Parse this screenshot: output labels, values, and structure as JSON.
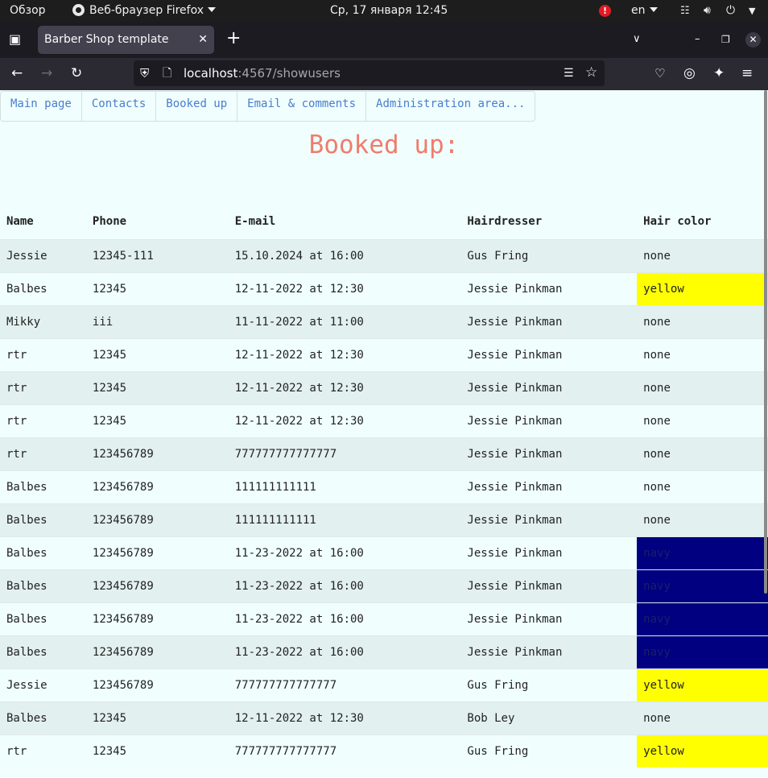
{
  "system_bar": {
    "activities": "Обзор",
    "app_name": "Веб-браузер Firefox",
    "clock": "Ср, 17 января  12:45",
    "notification_count": "!",
    "keyboard_layout": "en"
  },
  "browser": {
    "tab_title": "Barber Shop template",
    "url_host": "localhost",
    "url_rest": ":4567/showusers"
  },
  "menu": [
    "Main page",
    "Contacts",
    "Booked up",
    "Email & comments",
    "Administration area..."
  ],
  "page_title": "Booked up:",
  "table": {
    "headers": [
      "Name",
      "Phone",
      "E-mail",
      "Hairdresser",
      "Hair color"
    ],
    "rows": [
      [
        "Jessie",
        "12345-111",
        "15.10.2024 at 16:00",
        "Gus Fring",
        "none"
      ],
      [
        "Balbes",
        "12345",
        "12-11-2022 at 12:30",
        "Jessie Pinkman",
        "yellow"
      ],
      [
        "Mikky",
        "iii",
        "11-11-2022 at 11:00",
        "Jessie Pinkman",
        "none"
      ],
      [
        "rtr",
        "12345",
        "12-11-2022 at 12:30",
        "Jessie Pinkman",
        "none"
      ],
      [
        "rtr",
        "12345",
        "12-11-2022 at 12:30",
        "Jessie Pinkman",
        "none"
      ],
      [
        "rtr",
        "12345",
        "12-11-2022 at 12:30",
        "Jessie Pinkman",
        "none"
      ],
      [
        "rtr",
        "123456789",
        "777777777777777",
        "Jessie Pinkman",
        "none"
      ],
      [
        "Balbes",
        "123456789",
        "111111111111",
        "Jessie Pinkman",
        "none"
      ],
      [
        "Balbes",
        "123456789",
        "111111111111",
        "Jessie Pinkman",
        "none"
      ],
      [
        "Balbes",
        "123456789",
        "11-23-2022 at 16:00",
        "Jessie Pinkman",
        "navy"
      ],
      [
        "Balbes",
        "123456789",
        "11-23-2022 at 16:00",
        "Jessie Pinkman",
        "navy"
      ],
      [
        "Balbes",
        "123456789",
        "11-23-2022 at 16:00",
        "Jessie Pinkman",
        "navy"
      ],
      [
        "Balbes",
        "123456789",
        "11-23-2022 at 16:00",
        "Jessie Pinkman",
        "navy"
      ],
      [
        "Jessie",
        "123456789",
        "777777777777777",
        "Gus Fring",
        "yellow"
      ],
      [
        "Balbes",
        "12345",
        "12-11-2022 at 12:30",
        "Bob Ley",
        "none"
      ],
      [
        "rtr",
        "12345",
        "777777777777777",
        "Gus Fring",
        "yellow"
      ]
    ]
  },
  "colors": {
    "heading": "#f07c6b",
    "link": "#4a7dcc",
    "yellow": "#ffff00",
    "navy": "#000080"
  }
}
